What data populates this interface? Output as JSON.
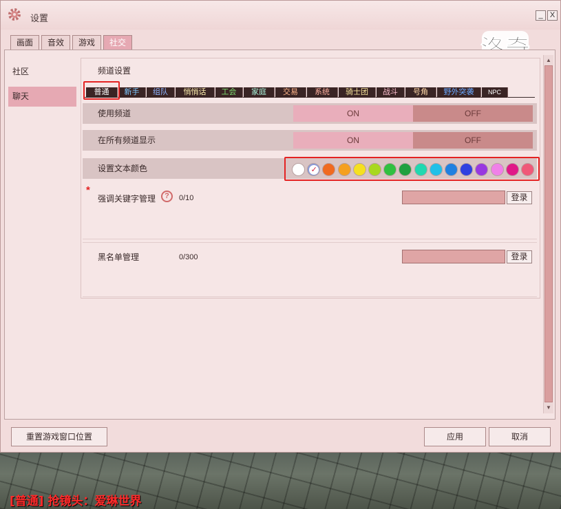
{
  "window": {
    "title": "设置",
    "minimize": "_",
    "close": "X"
  },
  "tabs": [
    {
      "label": "画面"
    },
    {
      "label": "音效"
    },
    {
      "label": "游戏"
    },
    {
      "label": "社交",
      "active": true
    }
  ],
  "sidebar": {
    "items": [
      {
        "label": "社区"
      },
      {
        "label": "聊天",
        "active": true
      }
    ]
  },
  "logo_text": "洛奇",
  "channel": {
    "section_title": "频道设置",
    "tabs": [
      {
        "label": "普通",
        "color": "#ffffff"
      },
      {
        "label": "新手",
        "color": "#7fc8ff"
      },
      {
        "label": "组队",
        "color": "#8fb4ff"
      },
      {
        "label": "悄悄话",
        "color": "#fff0b0"
      },
      {
        "label": "工会",
        "color": "#7edd70"
      },
      {
        "label": "家庭",
        "color": "#a8f0d8"
      },
      {
        "label": "交易",
        "color": "#ffb48a"
      },
      {
        "label": "系统",
        "color": "#ffb0a0"
      },
      {
        "label": "骑士团",
        "color": "#f5e29a"
      },
      {
        "label": "战斗",
        "color": "#ffc0d0"
      },
      {
        "label": "号角",
        "color": "#ffd7a8"
      },
      {
        "label": "野外突袭",
        "color": "#6aa8ff"
      },
      {
        "label": "NPC",
        "color": "#ffffff"
      }
    ]
  },
  "settings": {
    "use_channel": {
      "label": "使用频道",
      "on": "ON",
      "off": "OFF"
    },
    "show_all": {
      "label": "在所有频道显示",
      "on": "ON",
      "off": "OFF"
    },
    "text_color": {
      "label": "设置文本颜色",
      "swatches": [
        "#ffffff",
        "#8c9bd8",
        "#f06a20",
        "#f5a020",
        "#f5e020",
        "#a8d820",
        "#30c040",
        "#20a040",
        "#20d8b0",
        "#20c0e8",
        "#2080e0",
        "#3040e0",
        "#9838e0",
        "#f080e8",
        "#e01888",
        "#f05878"
      ],
      "selected_index": 1
    }
  },
  "keyword": {
    "label": "强调关键字管理",
    "count": "0/10",
    "button": "登录",
    "required_mark": "*",
    "help": "?"
  },
  "blacklist": {
    "label": "黑名单管理",
    "count": "0/300",
    "button": "登录"
  },
  "footer": {
    "reset": "重置游戏窗口位置",
    "apply": "应用",
    "cancel": "取消"
  },
  "chat_line": "[普通] 抢镜头：爱琳世界"
}
